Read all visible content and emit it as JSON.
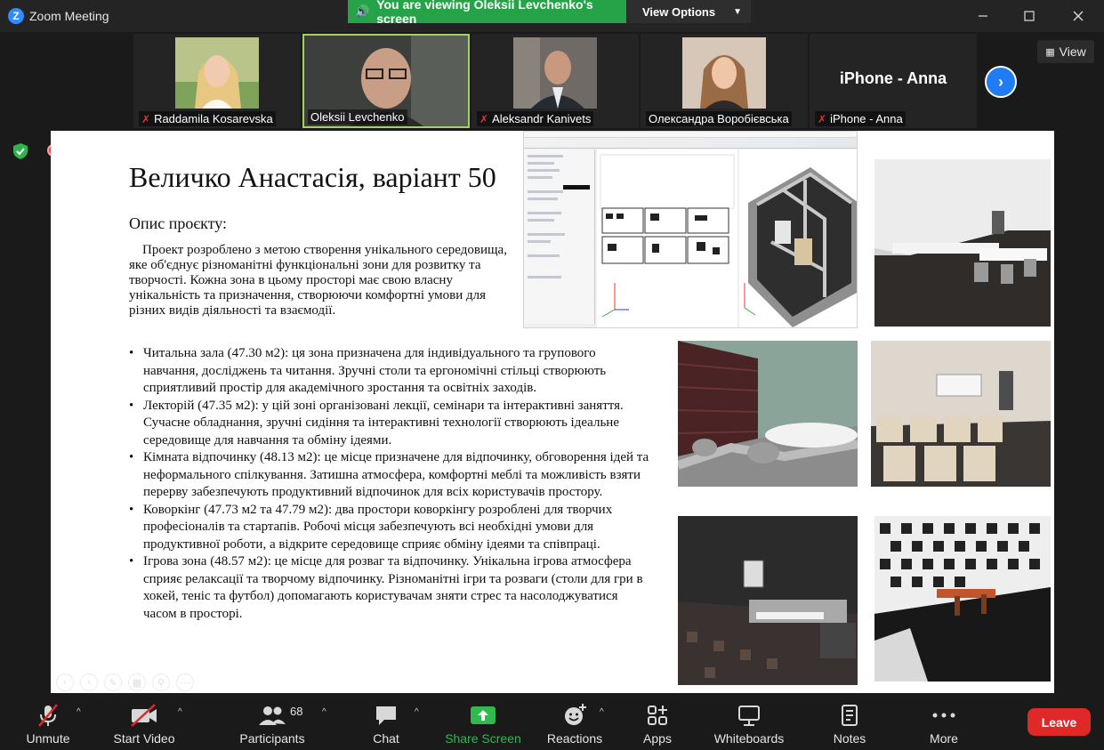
{
  "window": {
    "title": "Zoom Meeting",
    "banner": "You are viewing Oleksii Levchenko's screen",
    "view_options": "View Options"
  },
  "participants": [
    {
      "name": "Raddamila Kosarevska",
      "muted": true
    },
    {
      "name": "Oleksii Levchenko",
      "muted": false,
      "active": true
    },
    {
      "name": "Aleksandr Kanivets",
      "muted": true
    },
    {
      "name": "Олександра Воробієвська",
      "muted": false
    },
    {
      "name": "iPhone - Anna",
      "big_label": "iPhone - Anna",
      "muted": true
    }
  ],
  "view_button": "View",
  "slide": {
    "title": "Величко Анастасія, варіант 50",
    "description_heading": "Опис проєкту:",
    "description": "Проект розроблено з метою створення унікального середовища, яке об'єднує різноманітні функціональні зони для розвитку та творчості. Кожна зона в цьому просторі має свою власну унікальність та призначення, створюючи комфортні умови для різних видів діяльності та взаємодії.",
    "zones": [
      "Читальна зала (47.30 м2): ця зона призначена для індивідуального та групового навчання, досліджень та читання. Зручні столи та ергономічні стільці створюють сприятливий простір для академічного зростання та освітніх заходів.",
      "Лекторій (47.35 м2): у цій зоні організовані лекції, семінари та інтерактивні заняття. Сучасне обладнання, зручні сидіння та інтерактивні технології створюють ідеальне середовище для навчання та обміну ідеями.",
      "Кімната відпочинку (48.13 м2): це місце призначене для відпочинку, обговорення ідей та неформального спілкування. Затишна атмосфера, комфортні меблі та можливість взяти перерву забезпечують продуктивний відпочинок для всіх користувачів простору.",
      "Коворкінг (47.73 м2 та 47.79 м2): два простори коворкінгу розроблені для творчих професіоналів та стартапів. Робочі місця забезпечують всі необхідні умови для продуктивної роботи, а відкрите середовище сприяє обміну ідеями та співпраці.",
      "Ігрова зона (48.57 м2): це місце для розваг та відпочинку. Унікальна ігрова атмосфера сприяє релаксації та творчому відпочинку. Різноманітні ігри та розваги (столи для гри в хокей, теніс та футбол) допомагають користувачам зняти стрес та насолоджуватися часом в просторі."
    ]
  },
  "toolbar": {
    "unmute": "Unmute",
    "start_video": "Start Video",
    "participants": "Participants",
    "participants_count": "68",
    "chat": "Chat",
    "share_screen": "Share Screen",
    "reactions": "Reactions",
    "apps": "Apps",
    "whiteboards": "Whiteboards",
    "notes": "Notes",
    "more": "More",
    "leave": "Leave"
  },
  "colors": {
    "share_green": "#26a348",
    "active_border": "#a5d15e",
    "leave_red": "#e02828",
    "accent_blue": "#1f7cf2"
  }
}
